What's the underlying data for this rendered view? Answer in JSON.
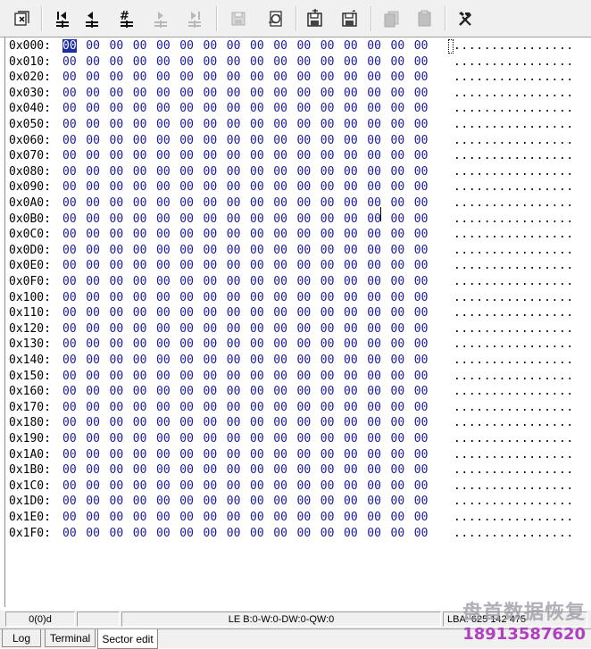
{
  "toolbar": {
    "buttons": [
      {
        "name": "exit-sector-icon",
        "enabled": true
      },
      {
        "name": "first-sector-icon",
        "enabled": true
      },
      {
        "name": "previous-sector-icon",
        "enabled": true
      },
      {
        "name": "goto-sector-icon",
        "enabled": true
      },
      {
        "name": "next-sector-icon",
        "enabled": false
      },
      {
        "name": "last-sector-icon",
        "enabled": false
      },
      {
        "name": "save-icon",
        "enabled": false
      },
      {
        "name": "refresh-icon",
        "enabled": true
      },
      {
        "name": "read-sector-icon",
        "enabled": true
      },
      {
        "name": "write-sector-icon",
        "enabled": true
      },
      {
        "name": "copy-icon",
        "enabled": false
      },
      {
        "name": "paste-icon",
        "enabled": false
      },
      {
        "name": "tools-icon",
        "enabled": true
      }
    ]
  },
  "hex": {
    "addresses": [
      "0x000:",
      "0x010:",
      "0x020:",
      "0x030:",
      "0x040:",
      "0x050:",
      "0x060:",
      "0x070:",
      "0x080:",
      "0x090:",
      "0x0A0:",
      "0x0B0:",
      "0x0C0:",
      "0x0D0:",
      "0x0E0:",
      "0x0F0:",
      "0x100:",
      "0x110:",
      "0x120:",
      "0x130:",
      "0x140:",
      "0x150:",
      "0x160:",
      "0x170:",
      "0x180:",
      "0x190:",
      "0x1A0:",
      "0x1B0:",
      "0x1C0:",
      "0x1D0:",
      "0x1E0:",
      "0x1F0:"
    ],
    "byte_value": "00",
    "bytes_per_row": 16,
    "ascii_value": "................",
    "selected_byte": "00"
  },
  "status": {
    "position": "0(0)d",
    "empty_cell": "",
    "values": "LE B:0-W:0-DW:0-QW:0",
    "lba": "LBA: 625 142 475"
  },
  "tabs": [
    {
      "label": "Log",
      "active": false
    },
    {
      "label": "Terminal",
      "active": false
    },
    {
      "label": "Sector edit",
      "active": true
    }
  ],
  "watermark": {
    "text": "盘首数据恢复",
    "phone": "18913587620"
  },
  "colors": {
    "hex_byte": "#1a1aa0",
    "selection": "#1e2ea6",
    "toolbar_bg": "#f0f0f0",
    "watermark_phone": "#b040c0"
  }
}
